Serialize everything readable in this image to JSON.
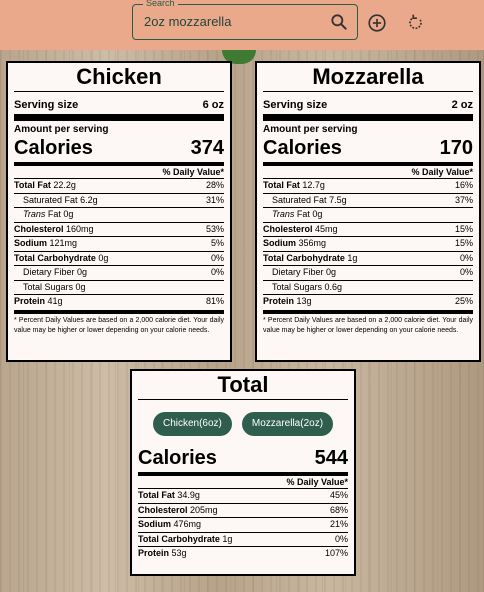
{
  "search": {
    "legend": "Search",
    "value": "2oz mozzarella"
  },
  "colors": {
    "header_bg": "#e9a98a",
    "accent": "#2f5e4f",
    "label_bg": "#fdf7f5"
  },
  "icons": [
    "search-icon",
    "add-circle-icon",
    "refresh-icon"
  ],
  "cards": [
    {
      "title": "Chicken",
      "serving_label": "Serving size",
      "serving_value": "6 oz",
      "amount_label": "Amount per serving",
      "calories_label": "Calories",
      "calories": "374",
      "dv_header": "% Daily Value*",
      "rows": {
        "total_fat": {
          "label": "Total Fat",
          "amount": "22.2g",
          "dv": "28%"
        },
        "sat_fat": {
          "label": "Saturated Fat",
          "amount": "6.2g",
          "dv": "31%"
        },
        "trans_fat": {
          "label": "Trans",
          "suffix": "Fat",
          "amount": "0g"
        },
        "cholesterol": {
          "label": "Cholesterol",
          "amount": "160mg",
          "dv": "53%"
        },
        "sodium": {
          "label": "Sodium",
          "amount": "121mg",
          "dv": "5%"
        },
        "carbs": {
          "label": "Total Carbohydrate",
          "amount": "0g",
          "dv": "0%"
        },
        "fiber": {
          "label": "Dietary Fiber",
          "amount": "0g",
          "dv": "0%"
        },
        "sugars": {
          "label": "Total Sugars",
          "amount": "0g"
        },
        "protein": {
          "label": "Protein",
          "amount": "41g",
          "dv": "81%"
        }
      },
      "footnote": "* Percent Daily Values are based on a 2,000 calorie diet. Your daily value may be higher or lower depending on your calorie needs."
    },
    {
      "title": "Mozzarella",
      "serving_label": "Serving size",
      "serving_value": "2 oz",
      "amount_label": "Amount per serving",
      "calories_label": "Calories",
      "calories": "170",
      "dv_header": "% Daily Value*",
      "rows": {
        "total_fat": {
          "label": "Total Fat",
          "amount": "12.7g",
          "dv": "16%"
        },
        "sat_fat": {
          "label": "Saturated Fat",
          "amount": "7.5g",
          "dv": "37%"
        },
        "trans_fat": {
          "label": "Trans",
          "suffix": "Fat",
          "amount": "0g"
        },
        "cholesterol": {
          "label": "Cholesterol",
          "amount": "45mg",
          "dv": "15%"
        },
        "sodium": {
          "label": "Sodium",
          "amount": "356mg",
          "dv": "15%"
        },
        "carbs": {
          "label": "Total Carbohydrate",
          "amount": "1g",
          "dv": "0%"
        },
        "fiber": {
          "label": "Dietary Fiber",
          "amount": "0g",
          "dv": "0%"
        },
        "sugars": {
          "label": "Total Sugars",
          "amount": "0.6g"
        },
        "protein": {
          "label": "Protein",
          "amount": "13g",
          "dv": "25%"
        }
      },
      "footnote": "* Percent Daily Values are based on a 2,000 calorie diet. Your daily value may be higher or lower depending on your calorie needs."
    }
  ],
  "total": {
    "title": "Total",
    "chips": [
      "Chicken(6oz)",
      "Mozzarella(2oz)"
    ],
    "calories_label": "Calories",
    "calories": "544",
    "dv_header": "% Daily Value*",
    "rows": {
      "total_fat": {
        "label": "Total Fat",
        "amount": "34.9g",
        "dv": "45%"
      },
      "cholesterol": {
        "label": "Cholesterol",
        "amount": "205mg",
        "dv": "68%"
      },
      "sodium": {
        "label": "Sodium",
        "amount": "476mg",
        "dv": "21%"
      },
      "carbs": {
        "label": "Total Carbohydrate",
        "amount": "1g",
        "dv": "0%"
      },
      "protein": {
        "label": "Protein",
        "amount": "53g",
        "dv": "107%"
      }
    }
  }
}
